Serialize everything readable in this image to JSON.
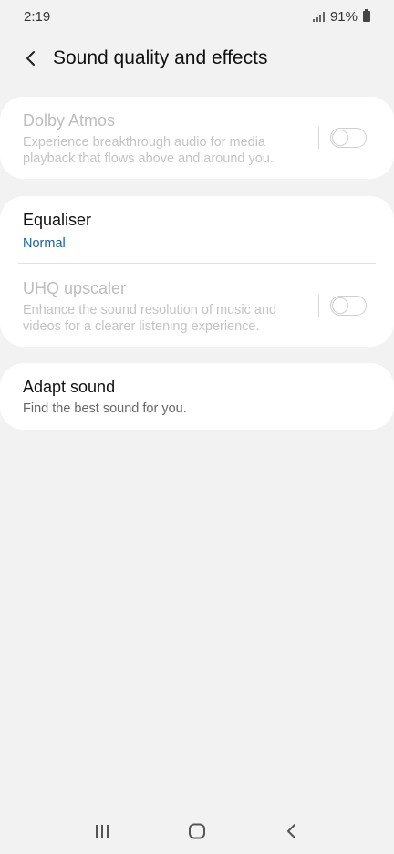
{
  "status": {
    "time": "2:19",
    "battery": "91%"
  },
  "header": {
    "title": "Sound quality and effects"
  },
  "dolby": {
    "title": "Dolby Atmos",
    "subtitle": "Experience breakthrough audio for media playback that flows above and around you.",
    "enabled": false,
    "on": false
  },
  "equaliser": {
    "title": "Equaliser",
    "value": "Normal"
  },
  "uhq": {
    "title": "UHQ upscaler",
    "subtitle": "Enhance the sound resolution of music and videos for a clearer listening experience.",
    "enabled": false,
    "on": false
  },
  "adapt": {
    "title": "Adapt sound",
    "subtitle": "Find the best sound for you."
  },
  "colors": {
    "background": "#f2f2f2",
    "card": "#ffffff",
    "accent": "#1a6496",
    "disabled": "#bdbdbd"
  },
  "nav": {
    "icons": [
      "recent-apps-icon",
      "home-icon",
      "back-icon"
    ]
  }
}
